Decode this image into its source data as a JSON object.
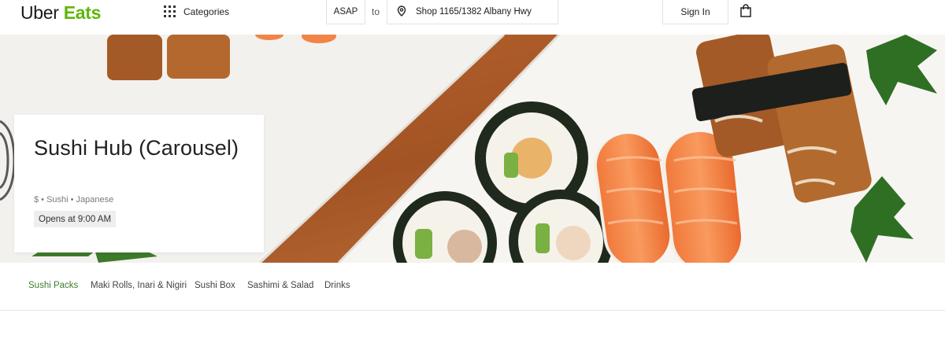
{
  "header": {
    "logo_primary": "Uber",
    "logo_secondary": "Eats",
    "categories_label": "Categories",
    "delivery_time": "ASAP",
    "to_label": "to",
    "address": "Shop 1165/1382 Albany Hwy",
    "signin_label": "Sign In"
  },
  "store": {
    "name": "Sushi Hub (Carousel)",
    "meta": "$ • Sushi • Japanese",
    "hours": "Opens at 9:00 AM"
  },
  "tabs": [
    {
      "label": "Sushi Packs",
      "active": true
    },
    {
      "label": "Maki Rolls, Inari & Nigiri",
      "active": false
    },
    {
      "label": "Sushi Box",
      "active": false
    },
    {
      "label": "Sashimi & Salad",
      "active": false
    },
    {
      "label": "Drinks",
      "active": false
    }
  ],
  "colors": {
    "brand_green": "#5fb709",
    "active_tab": "#3e7d2f"
  },
  "icons": [
    "grid-icon",
    "location-pin-icon",
    "shopping-bag-icon"
  ]
}
